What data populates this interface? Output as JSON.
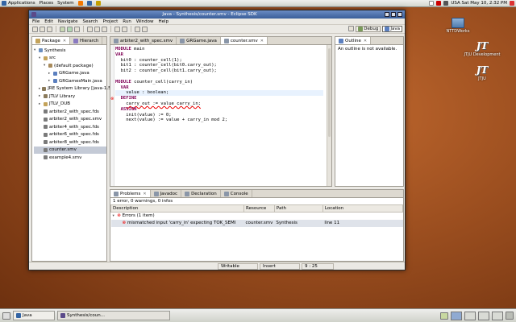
{
  "top_panel": {
    "menus": [
      "Applications",
      "Places",
      "System"
    ],
    "clock": "USA Sat May 10, 2:32 PM"
  },
  "desktop_icons": [
    {
      "label": "NTTDWorks",
      "icon": "folder-icon"
    },
    {
      "label": "JTJU Development",
      "icon": "jt-logo",
      "logo": "JT"
    },
    {
      "label": "JTJU",
      "icon": "jt-logo",
      "logo": "JT"
    }
  ],
  "window": {
    "title": "Java - Synthesis/counter.smv - Eclipse SDK",
    "menu": [
      "File",
      "Edit",
      "Navigate",
      "Search",
      "Project",
      "Run",
      "Window",
      "Help"
    ],
    "perspectives": [
      {
        "label": "Debug",
        "active": false
      },
      {
        "label": "Java",
        "active": true
      }
    ]
  },
  "package_explorer": {
    "tabs": [
      {
        "label": "Package",
        "active": true
      },
      {
        "label": "Hierarch",
        "active": false
      }
    ],
    "tree": [
      {
        "label": "Synthesis",
        "indent": 0,
        "arrow": "▾",
        "icon_color": "#6b8fbf",
        "icon": "project-icon"
      },
      {
        "label": "src",
        "indent": 1,
        "arrow": "▾",
        "icon_color": "#c4a35a",
        "icon": "source-folder-icon"
      },
      {
        "label": "(default package)",
        "indent": 2,
        "arrow": "▾",
        "icon_color": "#a88a5a",
        "icon": "package-icon"
      },
      {
        "label": "GRGame.java",
        "indent": 3,
        "arrow": "▸",
        "icon_color": "#5b7fbf",
        "icon": "java-file-icon"
      },
      {
        "label": "GRGamesMain.java",
        "indent": 3,
        "arrow": "▸",
        "icon_color": "#5b7fbf",
        "icon": "java-file-icon"
      },
      {
        "label": "JRE System Library [java-1.5.0-...]",
        "indent": 1,
        "arrow": "▸",
        "icon_color": "#8a7a5a",
        "icon": "library-icon"
      },
      {
        "label": "JTLV Library",
        "indent": 1,
        "arrow": "▸",
        "icon_color": "#8a7a5a",
        "icon": "library-icon"
      },
      {
        "label": "JTLV_DUB",
        "indent": 1,
        "arrow": "▸",
        "icon_color": "#c4a35a",
        "icon": "folder-icon"
      },
      {
        "label": "arbiter2_with_spec.fds",
        "indent": 1,
        "arrow": "",
        "icon_color": "#7a7a7a",
        "icon": "file-icon"
      },
      {
        "label": "arbiter2_with_spec.smv",
        "indent": 1,
        "arrow": "",
        "icon_color": "#7a7a7a",
        "icon": "file-icon"
      },
      {
        "label": "arbiter4_with_spec.fds",
        "indent": 1,
        "arrow": "",
        "icon_color": "#7a7a7a",
        "icon": "file-icon"
      },
      {
        "label": "arbiter6_with_spec.fds",
        "indent": 1,
        "arrow": "",
        "icon_color": "#7a7a7a",
        "icon": "file-icon"
      },
      {
        "label": "arbiter8_with_spec.fds",
        "indent": 1,
        "arrow": "",
        "icon_color": "#7a7a7a",
        "icon": "file-icon"
      },
      {
        "label": "counter.smv",
        "indent": 1,
        "arrow": "",
        "icon_color": "#7a7a7a",
        "icon": "file-icon",
        "selected": true
      },
      {
        "label": "example4.smv",
        "indent": 1,
        "arrow": "",
        "icon_color": "#7a7a7a",
        "icon": "file-icon"
      }
    ]
  },
  "editor": {
    "tabs": [
      {
        "label": "arbiter2_with_spec.smv",
        "active": false
      },
      {
        "label": "GRGame.java",
        "active": false
      },
      {
        "label": "counter.smv",
        "active": true
      }
    ],
    "lines": [
      {
        "kw": "MODULE",
        "text": " main",
        "indent": ""
      },
      {
        "kw": "VAR",
        "text": "",
        "indent": ""
      },
      {
        "kw": "",
        "text": "bit0 : counter_cell(1);",
        "indent": "  "
      },
      {
        "kw": "",
        "text": "bit1 : counter_cell(bit0.carry_out);",
        "indent": "  "
      },
      {
        "kw": "",
        "text": "bit2 : counter_cell(bit1.carry_out);",
        "indent": "  "
      },
      {
        "kw": "",
        "text": "",
        "indent": ""
      },
      {
        "kw": "MODULE",
        "text": " counter_cell(carry_in)",
        "indent": ""
      },
      {
        "kw": "VAR",
        "text": "",
        "indent": "  "
      },
      {
        "kw": "",
        "text": "value : boolean;",
        "indent": "    ",
        "highlight": true
      },
      {
        "kw": "DEFINE",
        "text": "",
        "indent": "  "
      },
      {
        "kw": "",
        "text": "carry_out := value carry_in;",
        "indent": "    ",
        "error": true
      },
      {
        "kw": "ASSIGN",
        "text": "",
        "indent": "  "
      },
      {
        "kw": "",
        "text": "init(value) := 0;",
        "indent": "    "
      },
      {
        "kw": "",
        "text": "next(value) := value + carry_in mod 2;",
        "indent": "    "
      }
    ]
  },
  "outline": {
    "tab": "Outline",
    "message": "An outline is not available."
  },
  "problems": {
    "tabs": [
      {
        "label": "Problems",
        "active": true
      },
      {
        "label": "Javadoc",
        "active": false
      },
      {
        "label": "Declaration",
        "active": false
      },
      {
        "label": "Console",
        "active": false
      }
    ],
    "summary": "1 error, 0 warnings, 0 infos",
    "columns": [
      "Description",
      "Resource",
      "Path",
      "Location"
    ],
    "group": "Errors (1 item)",
    "rows": [
      {
        "description": "mismatched input 'carry_in' expecting TOK_SEMI",
        "resource": "counter.smv",
        "path": "Synthesis",
        "location": "line 11"
      }
    ]
  },
  "statusbar": {
    "mode": "Writable",
    "insert": "Insert",
    "position": "9 : 25"
  },
  "bottom_panel": {
    "tasks": [
      {
        "label": "Java",
        "active": false
      },
      {
        "label": "Synthesis/coun...",
        "active": true
      }
    ]
  }
}
